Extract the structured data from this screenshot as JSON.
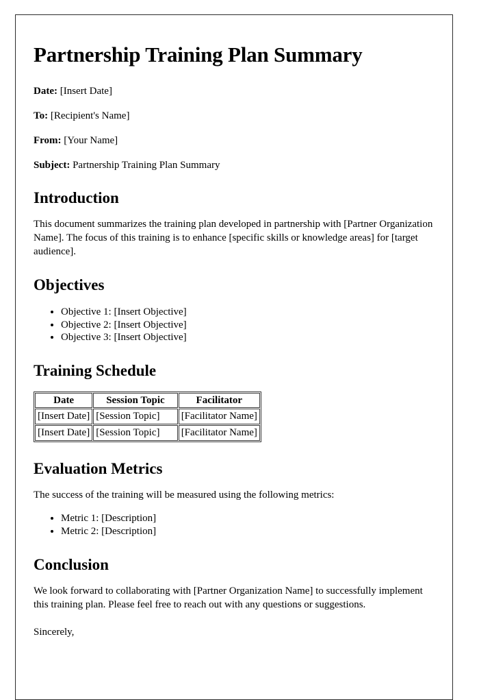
{
  "document": {
    "title": "Partnership Training Plan Summary",
    "meta": [
      {
        "label": "Date:",
        "value": "[Insert Date]"
      },
      {
        "label": "To:",
        "value": "[Recipient's Name]"
      },
      {
        "label": "From:",
        "value": "[Your Name]"
      },
      {
        "label": "Subject:",
        "value": "Partnership Training Plan Summary"
      }
    ],
    "introduction": {
      "heading": "Introduction",
      "paragraph": "This document summarizes the training plan developed in partnership with [Partner Organization Name]. The focus of this training is to enhance [specific skills or knowledge areas] for [target audience]."
    },
    "objectives": {
      "heading": "Objectives",
      "items": [
        "Objective 1: [Insert Objective]",
        "Objective 2: [Insert Objective]",
        "Objective 3: [Insert Objective]"
      ]
    },
    "training_schedule": {
      "heading": "Training Schedule",
      "columns": [
        "Date",
        "Session Topic",
        "Facilitator"
      ],
      "rows": [
        [
          "[Insert Date]",
          "[Session Topic]",
          "[Facilitator Name]"
        ],
        [
          "[Insert Date]",
          "[Session Topic]",
          "[Facilitator Name]"
        ]
      ]
    },
    "evaluation_metrics": {
      "heading": "Evaluation Metrics",
      "paragraph": "The success of the training will be measured using the following metrics:",
      "items": [
        "Metric 1: [Description]",
        "Metric 2: [Description]"
      ]
    },
    "conclusion": {
      "heading": "Conclusion",
      "paragraph": "We look forward to collaborating with [Partner Organization Name] to successfully implement this training plan. Please feel free to reach out with any questions or suggestions.",
      "signoff": "Sincerely,"
    }
  }
}
